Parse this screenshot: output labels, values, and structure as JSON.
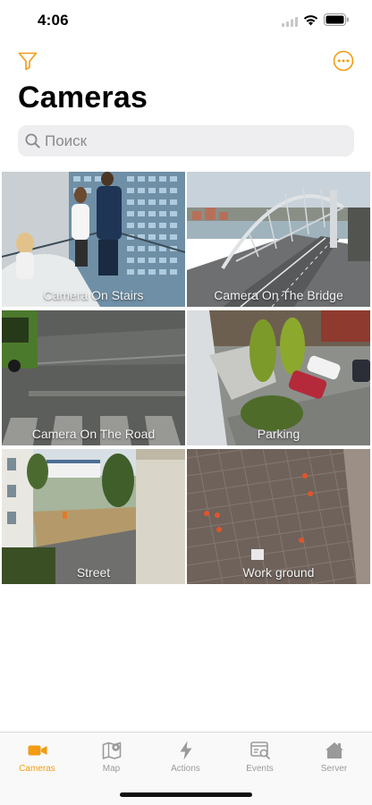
{
  "status": {
    "time": "4:06"
  },
  "header": {
    "title": "Cameras"
  },
  "search": {
    "placeholder": "Поиск",
    "value": ""
  },
  "theme": {
    "accent": "#F39C12",
    "inactive": "#9A9A9A",
    "search_bg": "#EEEEF0"
  },
  "cameras": [
    {
      "name": "Camera On Stairs"
    },
    {
      "name": "Camera On The Bridge"
    },
    {
      "name": "Camera On The Road"
    },
    {
      "name": "Parking"
    },
    {
      "name": "Street"
    },
    {
      "name": "Work ground"
    }
  ],
  "tabs": [
    {
      "label": "Cameras",
      "icon": "video-camera-icon",
      "active": true
    },
    {
      "label": "Map",
      "icon": "map-pin-icon",
      "active": false
    },
    {
      "label": "Actions",
      "icon": "lightning-icon",
      "active": false
    },
    {
      "label": "Events",
      "icon": "events-search-icon",
      "active": false
    },
    {
      "label": "Server",
      "icon": "home-icon",
      "active": false
    }
  ]
}
